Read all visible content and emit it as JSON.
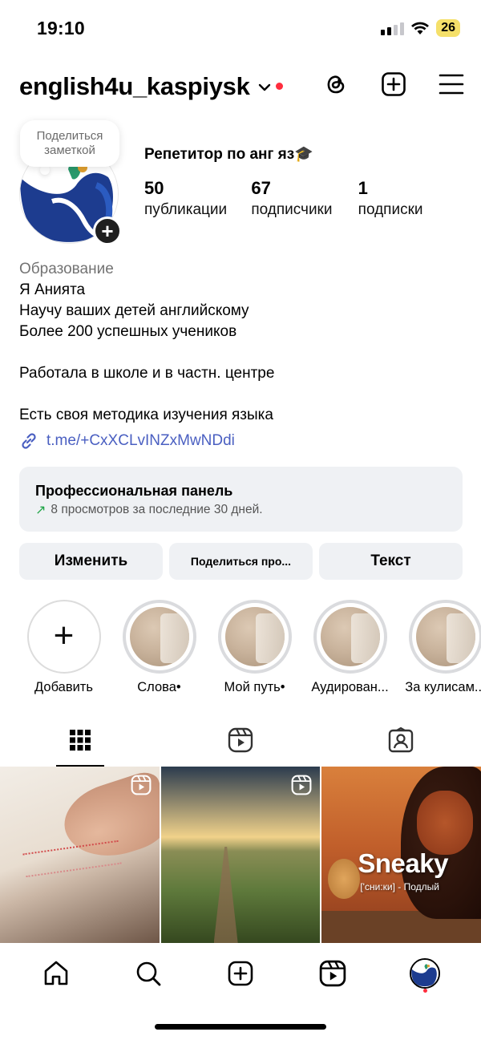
{
  "status_bar": {
    "time": "19:10",
    "battery": "26"
  },
  "header": {
    "username": "english4u_kaspiysk",
    "icons": [
      "threads-icon",
      "create-post-icon",
      "menu-icon"
    ]
  },
  "note": {
    "text": "Поделиться заметкой"
  },
  "profile": {
    "display_name": "Репетитор по анг яз🎓",
    "stats": [
      {
        "count": "50",
        "label": "публикации"
      },
      {
        "count": "67",
        "label": "подписчики"
      },
      {
        "count": "1",
        "label": "подписки"
      }
    ]
  },
  "bio": {
    "category": "Образование",
    "lines": [
      "Я Анията",
      "Научу ваших детей английскому",
      "Более 200 успешных учеников",
      "",
      "Работала в школе и в частн. центре",
      "",
      "Есть своя методика изучения языка"
    ],
    "link": "t.me/+CxXCLvINZxMwNDdi"
  },
  "pro_panel": {
    "title": "Профессиональная панель",
    "subtitle": "8 просмотров за последние 30 дней."
  },
  "buttons": {
    "edit": "Изменить",
    "share": "Поделиться про...",
    "text": "Текст"
  },
  "highlights": [
    {
      "label": "Добавить"
    },
    {
      "label": "Слова•"
    },
    {
      "label": "Мой путь•"
    },
    {
      "label": "Аудирован..."
    },
    {
      "label": "За кулисам..."
    }
  ],
  "posts": {
    "post3_title": "Sneaky",
    "post3_sub": "['сни:ки] - Подлый"
  },
  "colors": {
    "link": "#4a5fc1",
    "notification": "#ff2d3d",
    "panel_bg": "#eff1f4"
  }
}
